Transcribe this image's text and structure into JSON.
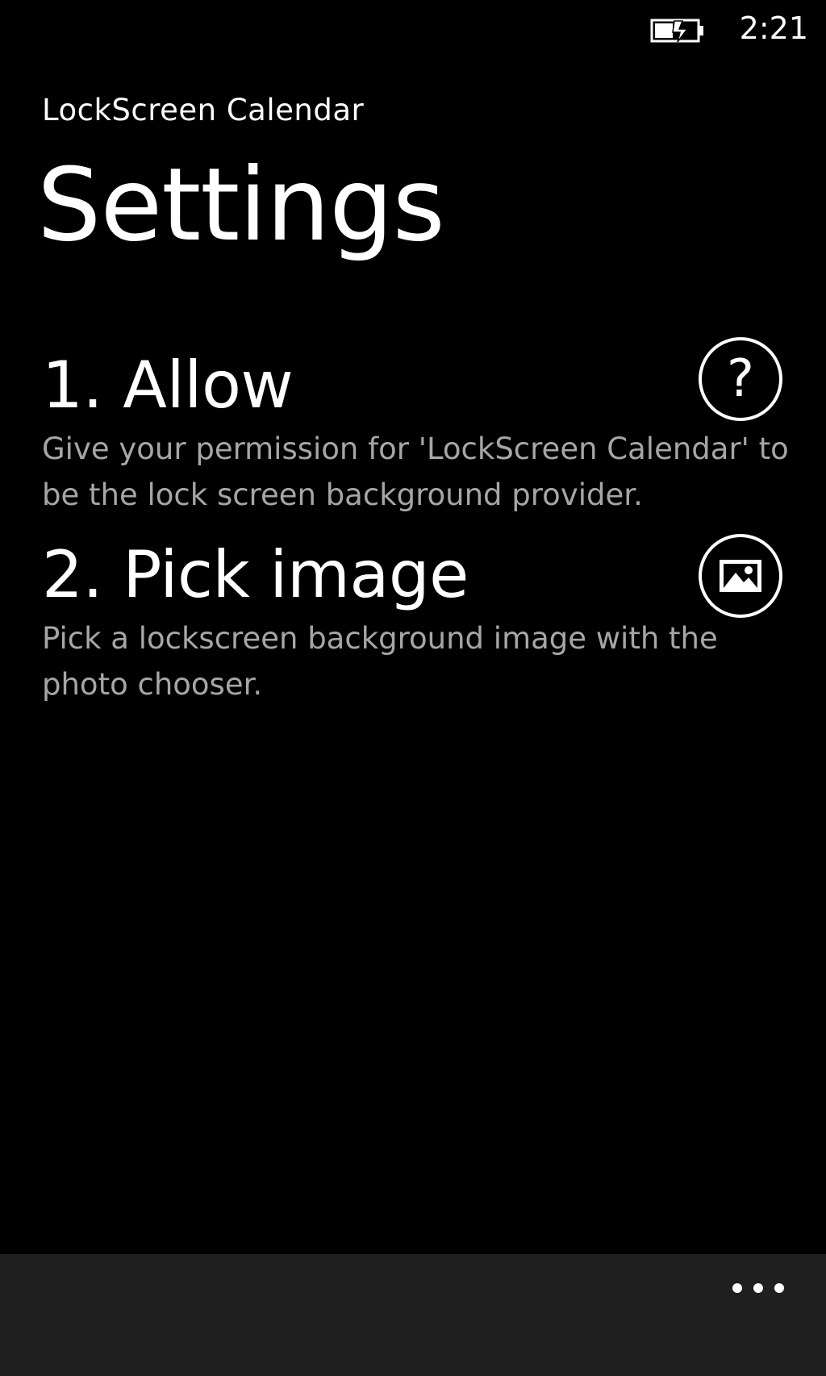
{
  "status_bar": {
    "time": "2:21",
    "battery_icon": "battery-charging-icon"
  },
  "header": {
    "app_title": "LockScreen Calendar",
    "page_title": "Settings"
  },
  "sections": [
    {
      "heading": "1. Allow",
      "description": "Give your permission for 'LockScreen Calendar' to be the lock screen background provider.",
      "action_icon": "question-mark-icon",
      "action_glyph": "?"
    },
    {
      "heading": "2. Pick image",
      "description": "Pick a lockscreen background image with the photo chooser.",
      "action_icon": "picture-icon"
    }
  ],
  "app_bar": {
    "more_icon": "ellipsis-icon"
  },
  "colors": {
    "background": "#000000",
    "foreground": "#ffffff",
    "subtle_text": "#a6a6a6",
    "app_bar": "#1f1f1f"
  }
}
